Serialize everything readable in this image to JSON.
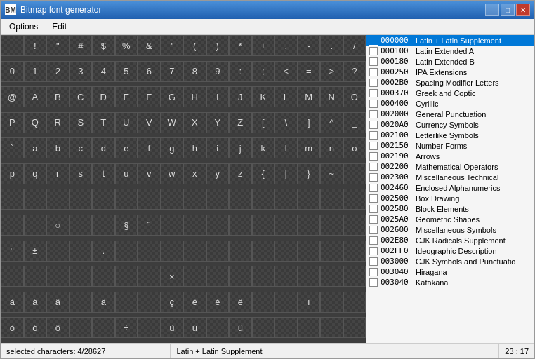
{
  "window": {
    "title": "Bitmap font generator",
    "icon_label": "BM"
  },
  "title_buttons": {
    "minimize": "—",
    "maximize": "□",
    "close": "✕"
  },
  "menu": {
    "items": [
      "Options",
      "Edit"
    ]
  },
  "unicode_ranges": [
    {
      "code": "000000",
      "name": "Latin + Latin Supplement",
      "checked": true,
      "selected": true
    },
    {
      "code": "000100",
      "name": "Latin Extended A",
      "checked": false,
      "selected": false
    },
    {
      "code": "000180",
      "name": "Latin Extended B",
      "checked": false,
      "selected": false
    },
    {
      "code": "000250",
      "name": "IPA Extensions",
      "checked": false,
      "selected": false
    },
    {
      "code": "0002B0",
      "name": "Spacing Modifier Letters",
      "checked": false,
      "selected": false
    },
    {
      "code": "000370",
      "name": "Greek and Coptic",
      "checked": false,
      "selected": false
    },
    {
      "code": "000400",
      "name": "Cyrillic",
      "checked": false,
      "selected": false
    },
    {
      "code": "002000",
      "name": "General Punctuation",
      "checked": false,
      "selected": false
    },
    {
      "code": "0020A0",
      "name": "Currency Symbols",
      "checked": false,
      "selected": false
    },
    {
      "code": "002100",
      "name": "Letterlike Symbols",
      "checked": false,
      "selected": false
    },
    {
      "code": "002150",
      "name": "Number Forms",
      "checked": false,
      "selected": false
    },
    {
      "code": "002190",
      "name": "Arrows",
      "checked": false,
      "selected": false
    },
    {
      "code": "002200",
      "name": "Mathematical Operators",
      "checked": false,
      "selected": false
    },
    {
      "code": "002300",
      "name": "Miscellaneous Technical",
      "checked": false,
      "selected": false
    },
    {
      "code": "002460",
      "name": "Enclosed Alphanumerics",
      "checked": false,
      "selected": false
    },
    {
      "code": "002500",
      "name": "Box Drawing",
      "checked": false,
      "selected": false
    },
    {
      "code": "002580",
      "name": "Block Elements",
      "checked": false,
      "selected": false
    },
    {
      "code": "0025A0",
      "name": "Geometric Shapes",
      "checked": false,
      "selected": false
    },
    {
      "code": "002600",
      "name": "Miscellaneous Symbols",
      "checked": false,
      "selected": false
    },
    {
      "code": "002E80",
      "name": "CJK Radicals Supplement",
      "checked": false,
      "selected": false
    },
    {
      "code": "002FF0",
      "name": "Ideographic Description",
      "checked": false,
      "selected": false
    },
    {
      "code": "003000",
      "name": "CJK Symbols and Punctuatio",
      "checked": false,
      "selected": false
    },
    {
      "code": "003040",
      "name": "Hiragana",
      "checked": false,
      "selected": false
    },
    {
      "code": "003040",
      "name": "Katakana",
      "checked": false,
      "selected": false
    }
  ],
  "char_rows": [
    [
      "",
      "!",
      "\"",
      "#",
      "$",
      "%",
      "&",
      "'",
      "(",
      ")",
      "*",
      "+",
      ",",
      "-",
      ".",
      "/"
    ],
    [
      "0",
      "1",
      "2",
      "3",
      "4",
      "5",
      "6",
      "7",
      "8",
      "9",
      ":",
      ";",
      "<",
      "=",
      ">",
      "?"
    ],
    [
      "@",
      "A",
      "B",
      "C",
      "D",
      "E",
      "F",
      "G",
      "H",
      "I",
      "J",
      "K",
      "L",
      "M",
      "N",
      "O"
    ],
    [
      "P",
      "Q",
      "R",
      "S",
      "T",
      "U",
      "V",
      "W",
      "X",
      "Y",
      "Z",
      "[",
      "\\",
      "]",
      "^",
      "_"
    ],
    [
      "`",
      "a",
      "b",
      "c",
      "d",
      "e",
      "f",
      "g",
      "h",
      "i",
      "j",
      "k",
      "l",
      "m",
      "n",
      "o"
    ],
    [
      "p",
      "q",
      "r",
      "s",
      "t",
      "u",
      "v",
      "w",
      "x",
      "y",
      "z",
      "{",
      "|",
      "}",
      "~",
      ""
    ],
    [
      "",
      "",
      "",
      "",
      "",
      "",
      "",
      "",
      "",
      "",
      "",
      "",
      "",
      "",
      "",
      ""
    ],
    [
      "",
      "",
      "○",
      "",
      "",
      "§",
      "¨",
      "",
      "",
      "",
      "",
      "",
      "",
      "",
      "",
      ""
    ],
    [
      "°",
      "±",
      "",
      "",
      ".",
      "",
      "",
      "",
      "",
      "",
      "",
      "",
      "",
      "",
      "",
      ""
    ],
    [
      "",
      "",
      "",
      "",
      "",
      "",
      "",
      "×",
      "",
      "",
      "",
      "",
      "",
      "",
      "",
      ""
    ],
    [
      "à",
      "á",
      "â",
      "",
      "ä",
      "",
      "",
      "ç",
      "è",
      "é",
      "ê",
      "",
      "",
      "ï",
      "",
      ""
    ],
    [
      "ò",
      "ó",
      "ô",
      "",
      "",
      "÷",
      "",
      "ù",
      "ú",
      "",
      "ü",
      "",
      "",
      "",
      "",
      ""
    ]
  ],
  "status": {
    "selected_chars": "selected characters: 4/28627",
    "range_name": "Latin + Latin Supplement",
    "position": "23 : 17"
  }
}
